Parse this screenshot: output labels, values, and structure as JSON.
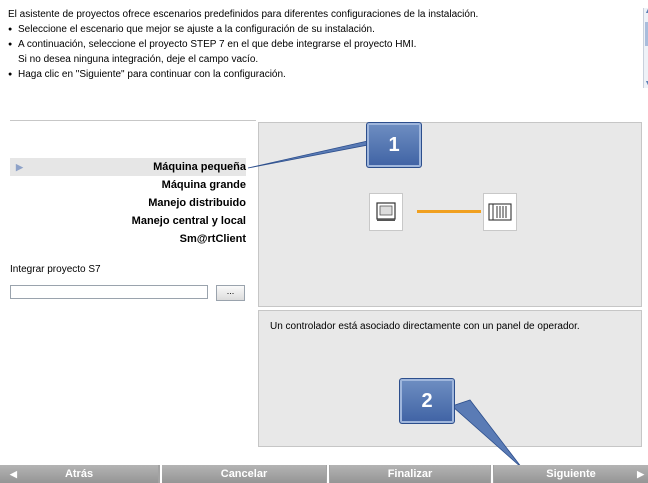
{
  "intro": {
    "line1": "El asistente de proyectos ofrece escenarios predefinidos para diferentes configuraciones de la instalación.",
    "bullet1": "Seleccione el escenario que mejor se ajuste a la configuración de su instalación.",
    "bullet2": "A continuación, seleccione el proyecto STEP 7 en el que debe integrarse el proyecto HMI.",
    "bullet2b": "Si no desea ninguna integración, deje el campo vacío.",
    "bullet3": "Haga clic en \"Siguiente\" para continuar con la configuración."
  },
  "scenarios": [
    {
      "label": "Máquina pequeña",
      "selected": true
    },
    {
      "label": "Máquina grande",
      "selected": false
    },
    {
      "label": "Manejo distribuido",
      "selected": false
    },
    {
      "label": "Manejo central y local",
      "selected": false
    },
    {
      "label": "Sm@rtClient",
      "selected": false
    }
  ],
  "s7": {
    "label": "Integrar proyecto S7",
    "value": "",
    "browse": "..."
  },
  "description": "Un controlador está asociado directamente con un panel de operador.",
  "callouts": {
    "one": "1",
    "two": "2"
  },
  "nav": {
    "back": "Atrás",
    "cancel": "Cancelar",
    "finish": "Finalizar",
    "next": "Siguiente"
  },
  "colors": {
    "link": "#f0a020",
    "callout": "#4f72b0",
    "nav": "#a3a3a3",
    "panel": "#e8e8e8"
  }
}
